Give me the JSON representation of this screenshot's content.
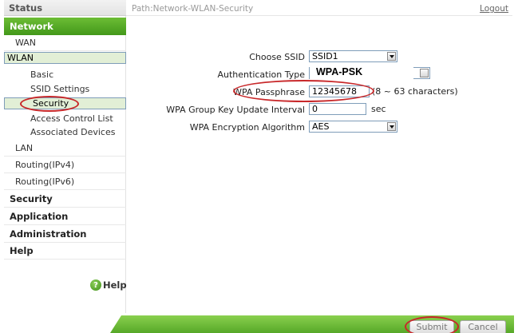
{
  "header": {
    "path": "Path:Network-WLAN-Security",
    "logout": "Logout"
  },
  "sidebar": {
    "status": "Status",
    "network": "Network",
    "wan": "WAN",
    "wlan": "WLAN",
    "basic": "Basic",
    "ssid_settings": "SSID Settings",
    "security_item": "Security",
    "acl": "Access Control List",
    "associated": "Associated Devices",
    "lan": "LAN",
    "routing_v4": "Routing(IPv4)",
    "routing_v6": "Routing(IPv6)",
    "security_section": "Security",
    "application": "Application",
    "administration": "Administration",
    "help_section": "Help",
    "help_button": "Help"
  },
  "form": {
    "choose_ssid_label": "Choose SSID",
    "choose_ssid_value": "SSID1",
    "auth_type_label": "Authentication Type",
    "auth_type_value": "WPA-PSK",
    "passphrase_label": "WPA Passphrase",
    "passphrase_value": "12345678",
    "passphrase_hint": "(8 ~ 63 characters)",
    "group_key_label": "WPA Group Key Update Interval",
    "group_key_value": "0",
    "group_key_unit": "sec",
    "encryption_label": "WPA Encryption Algorithm",
    "encryption_value": "AES"
  },
  "footer": {
    "submit": "Submit",
    "cancel": "Cancel"
  },
  "colors": {
    "accent_green": "#4fa321",
    "selected_bg": "#e2efd6",
    "annotation_red": "#c8282a"
  }
}
